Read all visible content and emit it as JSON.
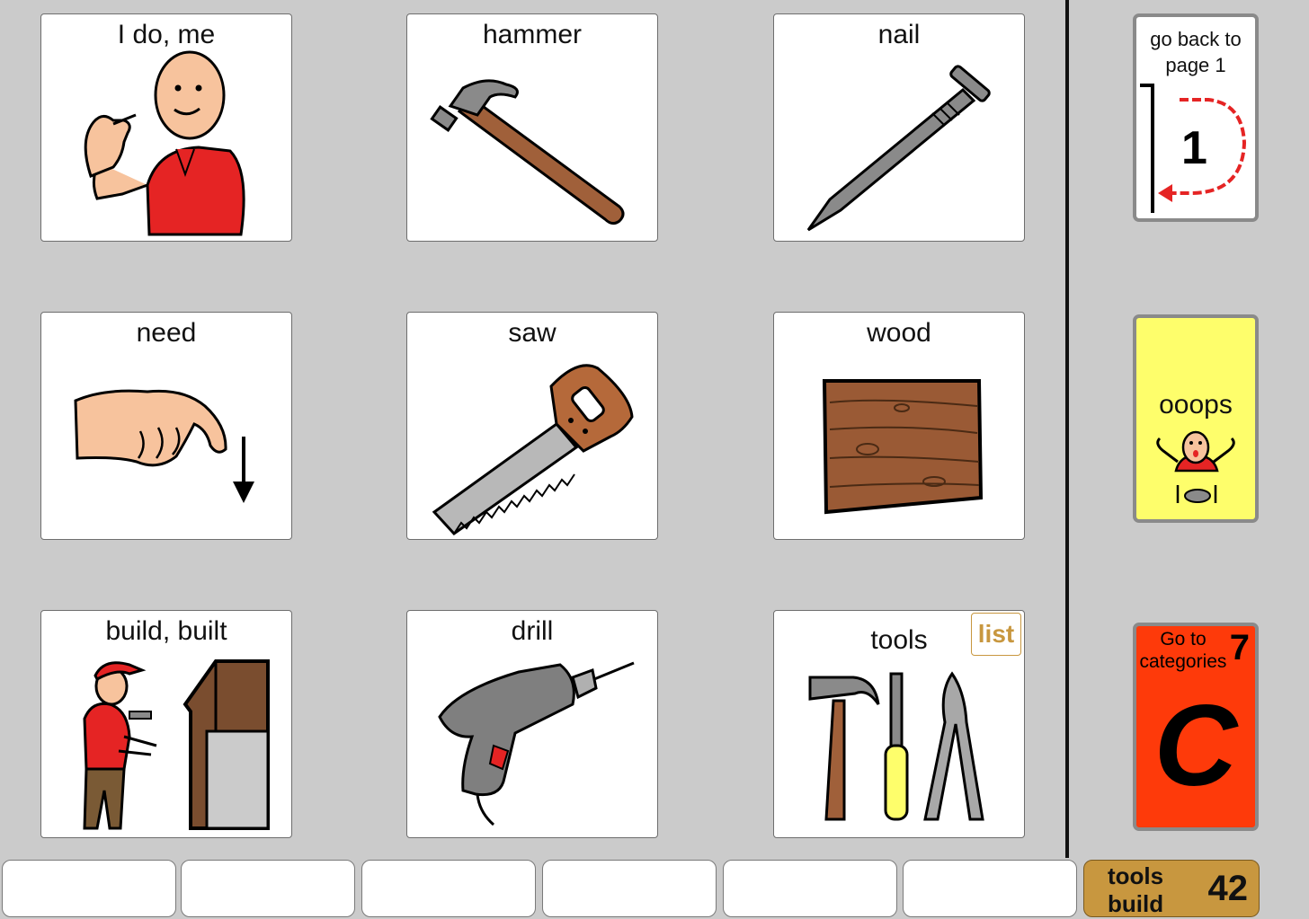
{
  "grid": {
    "cells": [
      {
        "label": "I do, me"
      },
      {
        "label": "hammer"
      },
      {
        "label": "nail"
      },
      {
        "label": "need"
      },
      {
        "label": "saw"
      },
      {
        "label": "wood"
      },
      {
        "label": "build,  built"
      },
      {
        "label": "drill"
      },
      {
        "label": "tools",
        "tag": "list"
      }
    ]
  },
  "sidebar": {
    "back": {
      "line1": "go back to",
      "line2": "page 1",
      "number": "1"
    },
    "oops": {
      "label": "ooops"
    },
    "categories": {
      "line1": "Go to",
      "line2": "categories",
      "number": "7",
      "letter": "C"
    }
  },
  "footer": {
    "badge": {
      "line1": "tools",
      "line2": "build",
      "number": "42"
    }
  },
  "colors": {
    "background": "#cbcbcb",
    "oops_yellow": "#fefe6b",
    "categories_red": "#fe3a0a",
    "badge_gold": "#c8973f",
    "list_tag": "#c8973f"
  }
}
